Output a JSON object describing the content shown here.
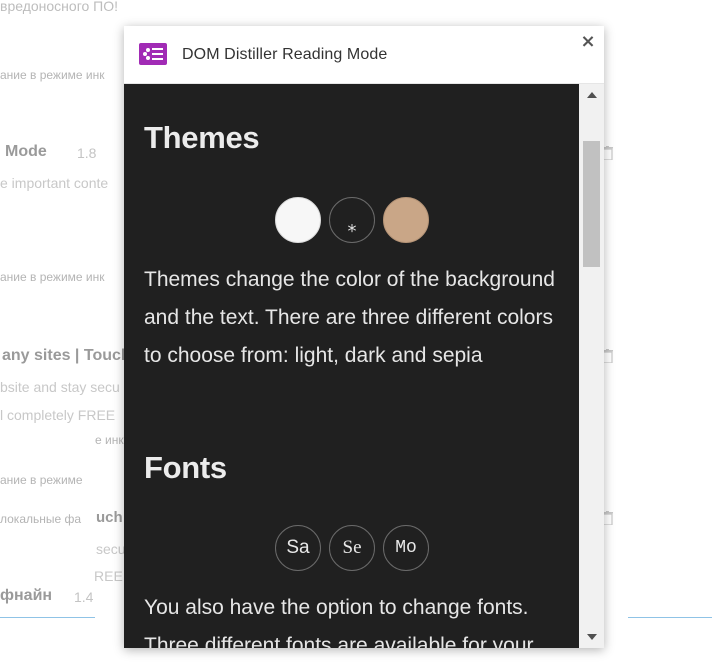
{
  "background": {
    "top_partial": "вредоносного ПО!",
    "status_lines": [
      "ание в режиме инк",
      "ание в режиме инк",
      "е инк",
      "ание в режиме",
      "локальные фа"
    ],
    "ext_names": [
      "Mode",
      "any sites | Touch",
      "фнайн"
    ],
    "versions": [
      "1.8",
      "1.4"
    ],
    "descriptions": [
      "e important conte",
      "bsite and stay secu",
      "l completely FREE",
      "uch",
      "secu",
      "REE!"
    ]
  },
  "popup": {
    "title": "DOM Distiller Reading Mode",
    "close_label": "×",
    "sections": {
      "themes_heading": "Themes",
      "themes_text": "Themes change the color of the background and the text. There are three different colors to choose from: light, dark and sepia",
      "fonts_heading": "Fonts",
      "fonts_text": "You also have the option to change fonts. Three different fonts are available for your"
    },
    "themes": [
      {
        "name": "light",
        "color": "#f7f7f7"
      },
      {
        "name": "dark",
        "color": "#202020",
        "selected_marker": "*"
      },
      {
        "name": "sepia",
        "color": "#c9a687"
      }
    ],
    "fonts": [
      {
        "label": "Sa"
      },
      {
        "label": "Se"
      },
      {
        "label": "Mo"
      }
    ]
  },
  "colors": {
    "accent": "#a12bb5",
    "content_bg": "#202020",
    "text_light": "#e6e6e6"
  }
}
